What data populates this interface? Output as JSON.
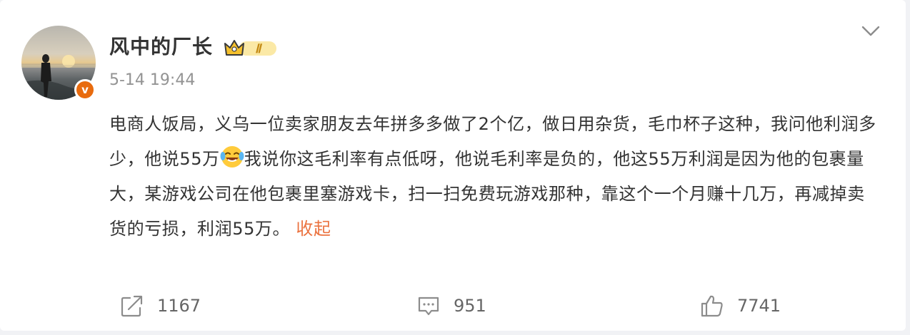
{
  "post": {
    "username": "风中的厂长",
    "level_badge": "Ⅱ",
    "timestamp": "5-14 19:44",
    "verified_badge": "v",
    "content_part1": "电商人饭局，义乌一位卖家朋友去年拼多多做了2个亿，做日用杂货，毛巾杯子这种，我问他利润多少，他说55万",
    "emoji": "laugh-cry-emoji",
    "content_part2": "我说你这毛利率有点低呀，他说毛利率是负的，他这55万利润是因为他的包裹量大，某游戏公司在他包裹里塞游戏卡，扫一扫免费玩游戏那种，靠这个一个月赚十几万，再减掉卖货的亏损，利润55万。",
    "collapse_label": "收起"
  },
  "actions": {
    "repost_count": "1167",
    "comment_count": "951",
    "like_count": "7741"
  },
  "icons": {
    "menu": "chevron-down-icon",
    "repost": "repost-icon",
    "comment": "comment-icon",
    "like": "thumbs-up-icon"
  },
  "colors": {
    "accent": "#eb7340",
    "verified": "#e86b0e",
    "crown": "#f5c02c"
  }
}
